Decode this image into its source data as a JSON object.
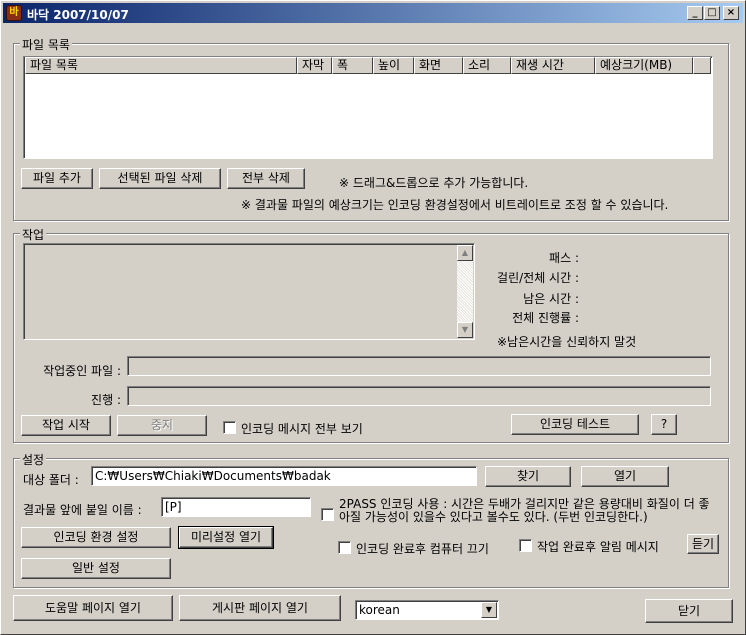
{
  "window": {
    "title": "바닥 2007/10/07",
    "app_icon_glyph": "바",
    "minimize_glyph": "_",
    "maximize_glyph": "□",
    "close_glyph": "×"
  },
  "files": {
    "group_label": "파일 목록",
    "columns": [
      "파일 목록",
      "자막",
      "폭",
      "높이",
      "화면",
      "소리",
      "재생 시간",
      "예상크기(MB)"
    ],
    "add_button": "파일 추가",
    "delete_selected_button": "선택된 파일 삭제",
    "delete_all_button": "전부 삭제",
    "drag_note": "※ 드래그&드롭으로 추가 가능합니다.",
    "size_note": "※ 결과물 파일의 예상크기는 인코딩 환경설정에서 비트레이트로 조정 할 수 있습니다."
  },
  "work": {
    "group_label": "작업",
    "pass_label": "패스 :",
    "elapsed_label": "걸린/전체 시간 :",
    "remaining_label": "남은 시간 :",
    "total_progress_label": "전체 진행률 :",
    "remaining_note": "※남은시간을 신뢰하지 말것",
    "current_file_label": "작업중인 파일 :",
    "current_file_value": "",
    "progress_label": "진행 :",
    "start_button": "작업 시작",
    "stop_button": "중지",
    "show_all_messages_label": "인코딩 메시지 전부 보기",
    "show_all_messages_checked": false,
    "encoding_test_button": "인코딩 테스트",
    "help_button": "?"
  },
  "settings": {
    "group_label": "설정",
    "target_folder_label": "대상 폴더 :",
    "target_folder_value": "C:₩Users₩Chiaki₩Documents₩badak",
    "browse_button": "찾기",
    "open_button": "열기",
    "prefix_label": "결과물 앞에 붙일 이름 :",
    "prefix_value": "[P]",
    "twopass_text": "2PASS 인코딩 사용 : 시간은 두배가 걸리지만 같은 용량대비 화질이 더 좋아질 가능성이 있을수 있다고 볼수도 있다. (두번 인코딩한다.)",
    "twopass_checked": false,
    "encoding_settings_button": "인코딩 환경 설정",
    "open_preset_button": "미리설정 열기",
    "shutdown_label": "인코딩 완료후 컴퓨터 끄기",
    "shutdown_checked": false,
    "notify_label": "작업 완료후 알림 메시지",
    "notify_checked": false,
    "listen_button": "듣기",
    "general_settings_button": "일반 설정"
  },
  "footer": {
    "help_page_button": "도움말 페이지 열기",
    "board_page_button": "게시판 페이지 열기",
    "language_value": "korean",
    "close_button": "닫기"
  },
  "icons": {
    "scroll_up": "▲",
    "scroll_down": "▼",
    "combo_arrow": "▼"
  }
}
